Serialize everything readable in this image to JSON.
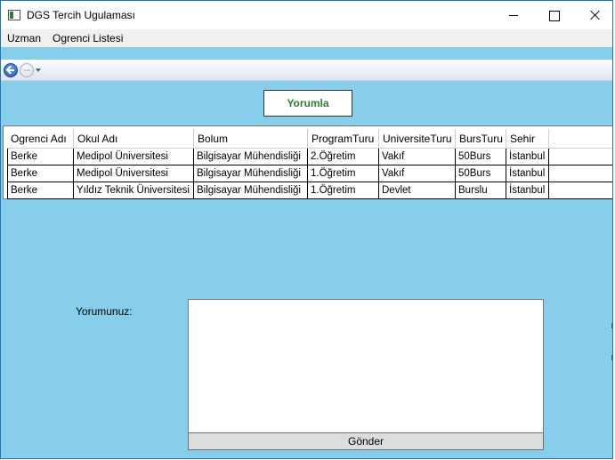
{
  "window": {
    "title": "DGS Tercih Ugulaması"
  },
  "menu": {
    "items": [
      "Uzman",
      "Ogrenci Listesi"
    ]
  },
  "toolbar": {
    "yorumla_label": "Yorumla"
  },
  "grid": {
    "columns": [
      "Ogrenci Adı",
      "Okul Adı",
      "Bolum",
      "ProgramTuru",
      "UniversiteTuru",
      "BursTuru",
      "Sehir"
    ],
    "rows": [
      [
        "Berke",
        "Medipol Üniversitesi",
        "Bilgisayar Mühendisliği",
        "2.Öğretim",
        "Vakıf",
        "50Burs",
        "İstanbul"
      ],
      [
        "Berke",
        "Medipol Üniversitesi",
        "Bilgisayar Mühendisliği",
        "1.Öğretim",
        "Vakıf",
        "50Burs",
        "İstanbul"
      ],
      [
        "Berke",
        "Yıldız Teknik Üniversitesi",
        "Bilgisayar Mühendisliği",
        "1.Öğretim",
        "Devlet",
        "Burslu",
        "İstanbul"
      ]
    ]
  },
  "comment": {
    "label": "Yorumunuz:",
    "value": "",
    "submit_label": "Gönder"
  },
  "colors": {
    "background": "#87ceeb",
    "yorumla_text": "#2e7d32",
    "window_border": "#1b73c4"
  }
}
